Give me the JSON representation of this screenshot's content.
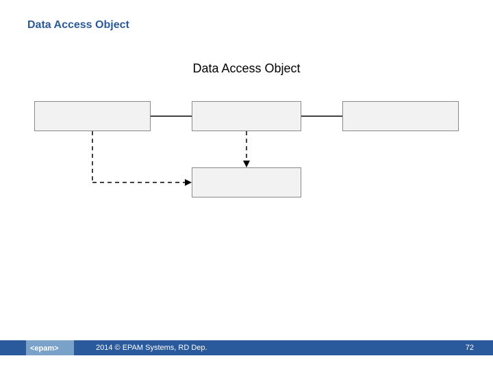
{
  "slide": {
    "title": "Data Access Object",
    "diagram_title": "Data Access Object"
  },
  "diagram": {
    "boxes": {
      "a": "",
      "b": "",
      "c": "",
      "d": ""
    }
  },
  "footer": {
    "logo_text": "<epam>",
    "copyright": "2014 © EPAM Systems, RD Dep.",
    "page": "72"
  },
  "colors": {
    "accent": "#2a5a9b",
    "box_fill": "#f2f2f2",
    "box_border": "#888888",
    "logo_chip": "#7aa2c8"
  }
}
